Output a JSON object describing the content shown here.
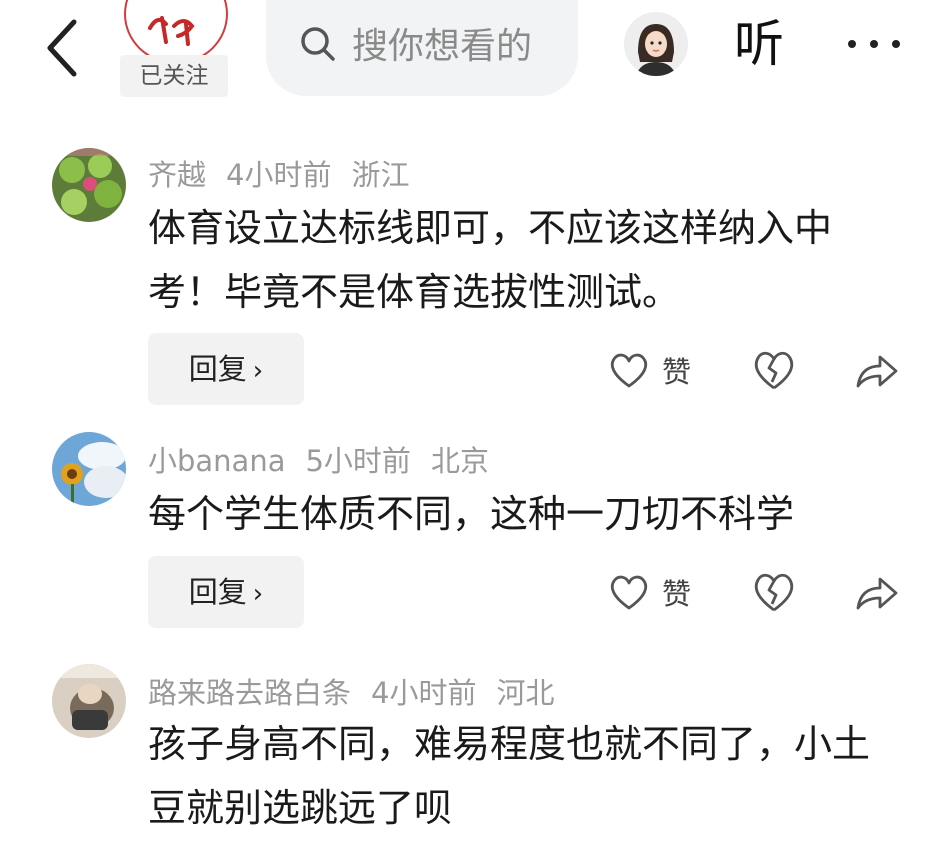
{
  "header": {
    "follow_status": "已关注",
    "search_placeholder": "搜你想看的",
    "listen_label": "听",
    "icons": [
      "back-icon",
      "search-icon",
      "more-icon"
    ]
  },
  "comments": [
    {
      "username": "齐越",
      "time": "4小时前",
      "location": "浙江",
      "text": "体育设立达标线即可，不应该这样纳入中考！毕竟不是体育选拔性测试。",
      "reply_label": "回复",
      "like_label": "赞"
    },
    {
      "username": "小banana",
      "time": "5小时前",
      "location": "北京",
      "text": "每个学生体质不同，这种一刀切不科学",
      "reply_label": "回复",
      "like_label": "赞"
    },
    {
      "username": "路来路去路白条",
      "time": "4小时前",
      "location": "河北",
      "text": "孩子身高不同，难易程度也就不同了，小土豆就别选跳远了呗"
    }
  ]
}
